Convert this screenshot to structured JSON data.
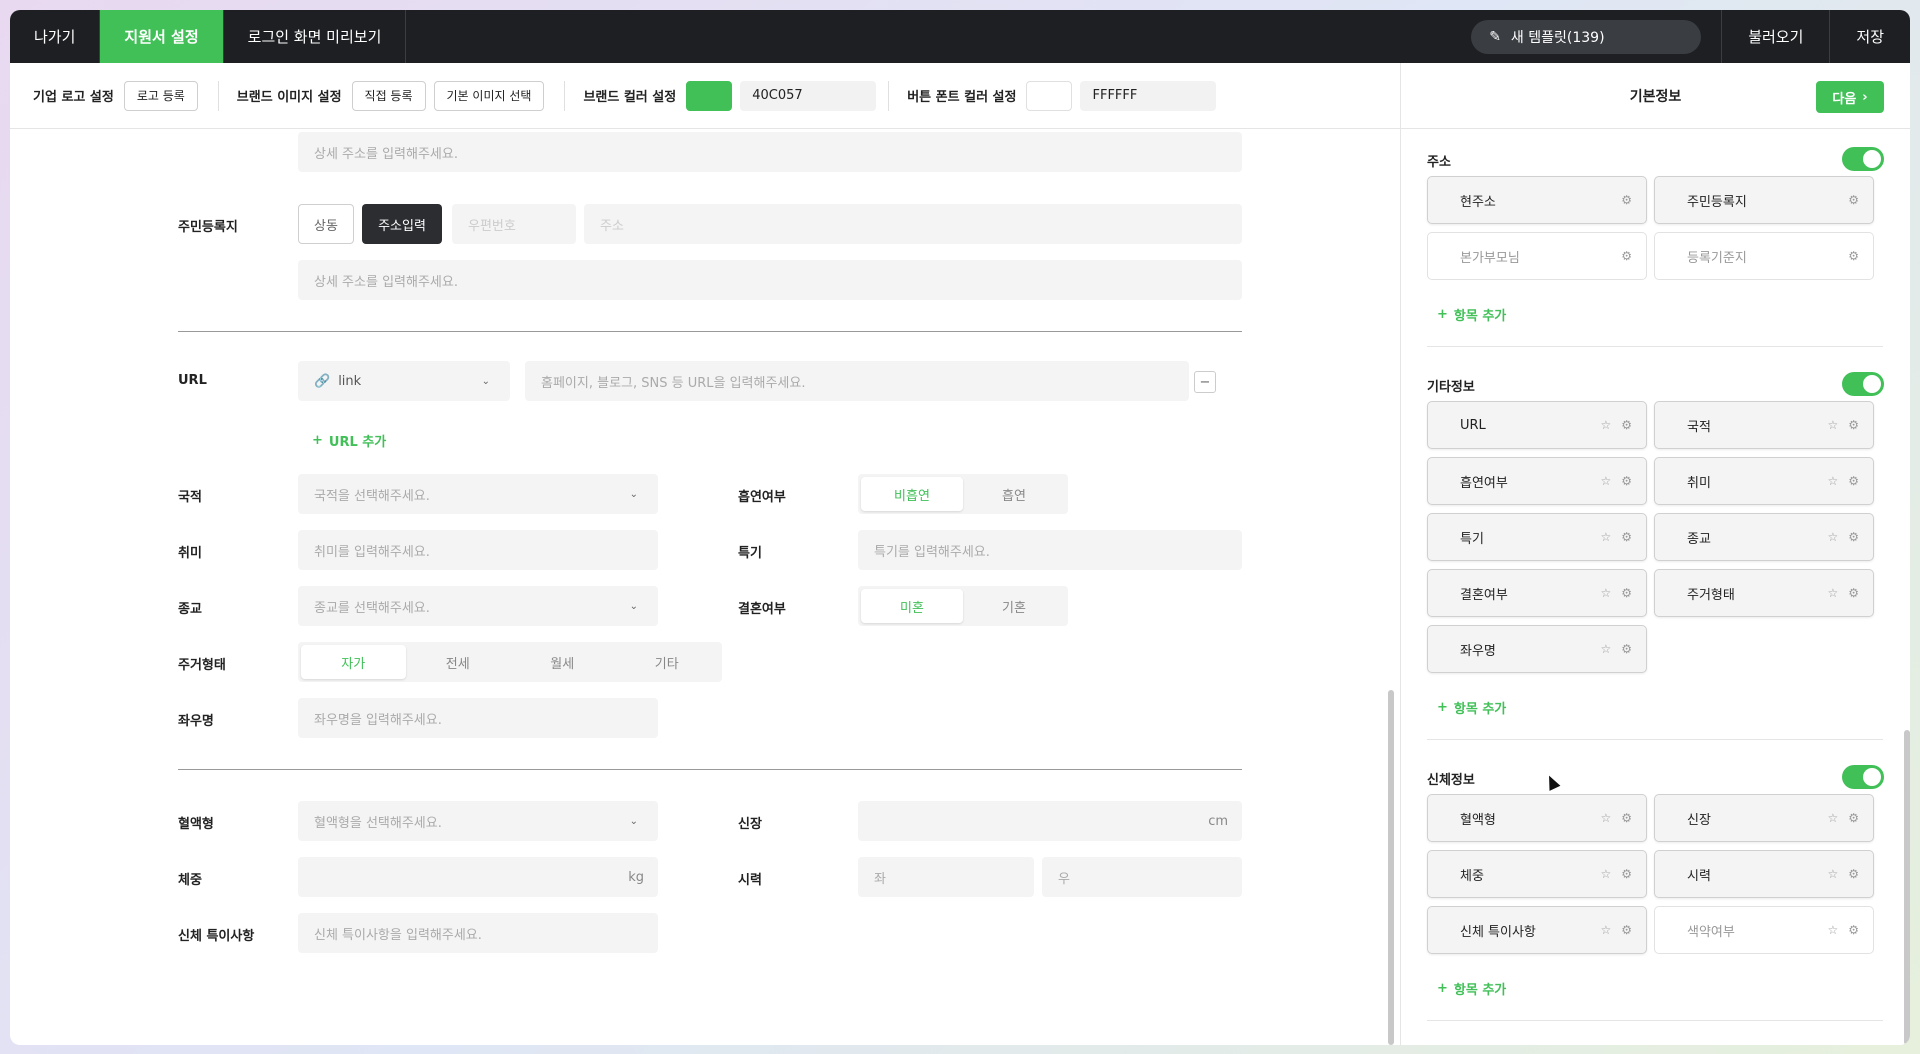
{
  "topbar": {
    "tabs": [
      {
        "label": "나가기"
      },
      {
        "label": "지원서 설정",
        "active": true
      },
      {
        "label": "로그인 화면 미리보기"
      }
    ],
    "template_button": "새 템플릿(139)",
    "load_label": "불러오기",
    "save_label": "저장"
  },
  "toolbar": {
    "logo_label": "기업 로고 설정",
    "logo_button": "로고 등록",
    "brand_image_label": "브랜드 이미지 설정",
    "direct_button": "직접 등록",
    "default_image_button": "기본 이미지 선택",
    "brand_color_label": "브랜드 컬러 설정",
    "brand_color_hex": "40C057",
    "brand_color": "#40c057",
    "button_font_label": "버튼 폰트 컬러 설정",
    "button_font_hex": "FFFFFF",
    "button_font_color": "#ffffff"
  },
  "right_panel": {
    "title": "기본정보",
    "next_button": "다음",
    "sections": {
      "address": {
        "title": "주소",
        "enabled": true,
        "items": [
          {
            "label": "현주소",
            "active": true
          },
          {
            "label": "주민등록지",
            "active": true
          },
          {
            "label": "본가부모님",
            "active": false
          },
          {
            "label": "등록기준지",
            "active": false
          }
        ],
        "add_label": "항목 추가"
      },
      "other": {
        "title": "기타정보",
        "enabled": true,
        "items": [
          {
            "label": "URL"
          },
          {
            "label": "국적"
          },
          {
            "label": "흡연여부"
          },
          {
            "label": "취미"
          },
          {
            "label": "특기"
          },
          {
            "label": "종교"
          },
          {
            "label": "결혼여부"
          },
          {
            "label": "주거형태"
          },
          {
            "label": "좌우명"
          }
        ],
        "add_label": "항목 추가"
      },
      "body": {
        "title": "신체정보",
        "enabled": true,
        "items": [
          {
            "label": "혈액형",
            "active": true
          },
          {
            "label": "신장",
            "active": true
          },
          {
            "label": "체중",
            "active": true
          },
          {
            "label": "시력",
            "active": true
          },
          {
            "label": "신체 특이사항",
            "active": true
          },
          {
            "label": "색약여부",
            "active": false
          }
        ],
        "add_label": "항목 추가"
      }
    }
  },
  "form": {
    "detail_address_placeholder": "상세 주소를 입력해주세요.",
    "resident_label": "주민등록지",
    "same_button": "상동",
    "address_input_button": "주소입력",
    "postcode_placeholder": "우편번호",
    "address_placeholder": "주소",
    "detail_address_placeholder2": "상세 주소를 입력해주세요.",
    "url_label": "URL",
    "url_type": "link",
    "url_placeholder": "홈페이지, 블로그, SNS 등 URL을 입력해주세요.",
    "url_add": "URL 추가",
    "nationality_label": "국적",
    "nationality_placeholder": "국적을 선택해주세요.",
    "smoking_label": "흡연여부",
    "smoking_options": [
      "비흡연",
      "흡연"
    ],
    "hobby_label": "취미",
    "hobby_placeholder": "취미를 입력해주세요.",
    "talent_label": "특기",
    "talent_placeholder": "특기를 입력해주세요.",
    "religion_label": "종교",
    "religion_placeholder": "종교를 선택해주세요.",
    "marriage_label": "결혼여부",
    "marriage_options": [
      "미혼",
      "기혼"
    ],
    "housing_label": "주거형태",
    "housing_options": [
      "자가",
      "전세",
      "월세",
      "기타"
    ],
    "motto_label": "좌우명",
    "motto_placeholder": "좌우명을 입력해주세요.",
    "blood_label": "혈액형",
    "blood_placeholder": "혈액형을 선택해주세요.",
    "height_label": "신장",
    "height_unit": "cm",
    "weight_label": "체중",
    "weight_unit": "kg",
    "vision_label": "시력",
    "vision_left": "좌",
    "vision_right": "우",
    "body_note_label": "신체 특이사항",
    "body_note_placeholder": "신체 특이사항을 입력해주세요."
  }
}
